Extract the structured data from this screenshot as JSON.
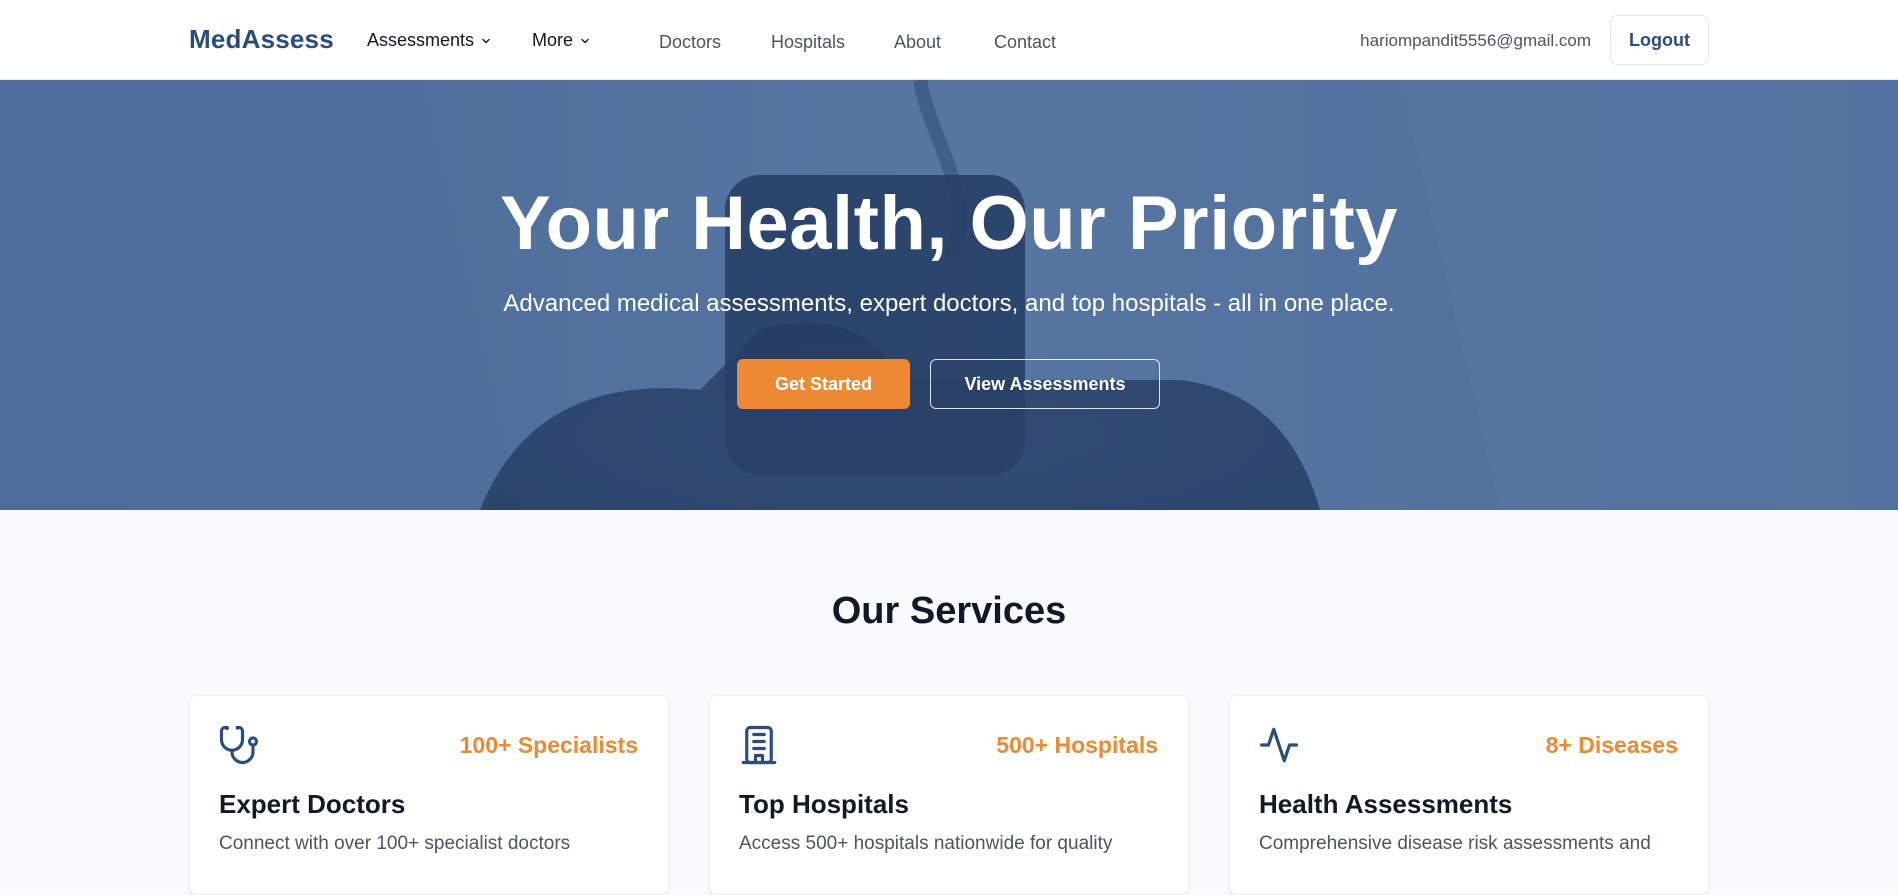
{
  "nav": {
    "brand": "MedAssess",
    "dropdowns": [
      "Assessments",
      "More"
    ],
    "links": [
      "Doctors",
      "Hospitals",
      "About",
      "Contact"
    ],
    "user_email": "hariompandit5556@gmail.com",
    "logout_label": "Logout"
  },
  "hero": {
    "title": "Your Health, Our Priority",
    "subtitle": "Advanced medical assessments, expert doctors, and top hospitals - all in one place.",
    "primary_button": "Get Started",
    "secondary_button": "View Assessments"
  },
  "services": {
    "title": "Our Services",
    "cards": [
      {
        "icon": "stethoscope-icon",
        "stat": "100+ Specialists",
        "title": "Expert Doctors",
        "desc": "Connect with over 100+ specialist doctors"
      },
      {
        "icon": "hospital-building-icon",
        "stat": "500+ Hospitals",
        "title": "Top Hospitals",
        "desc": "Access 500+ hospitals nationwide for quality"
      },
      {
        "icon": "activity-pulse-icon",
        "stat": "8+ Diseases",
        "title": "Health Assessments",
        "desc": "Comprehensive disease risk assessments and"
      }
    ]
  },
  "colors": {
    "brand": "#2b4c7e",
    "accent": "#ed8a33",
    "hero_overlay": "#2b4c7e",
    "text_dark": "#111827",
    "text_muted": "#4b5563",
    "background": "#f8fafc"
  }
}
